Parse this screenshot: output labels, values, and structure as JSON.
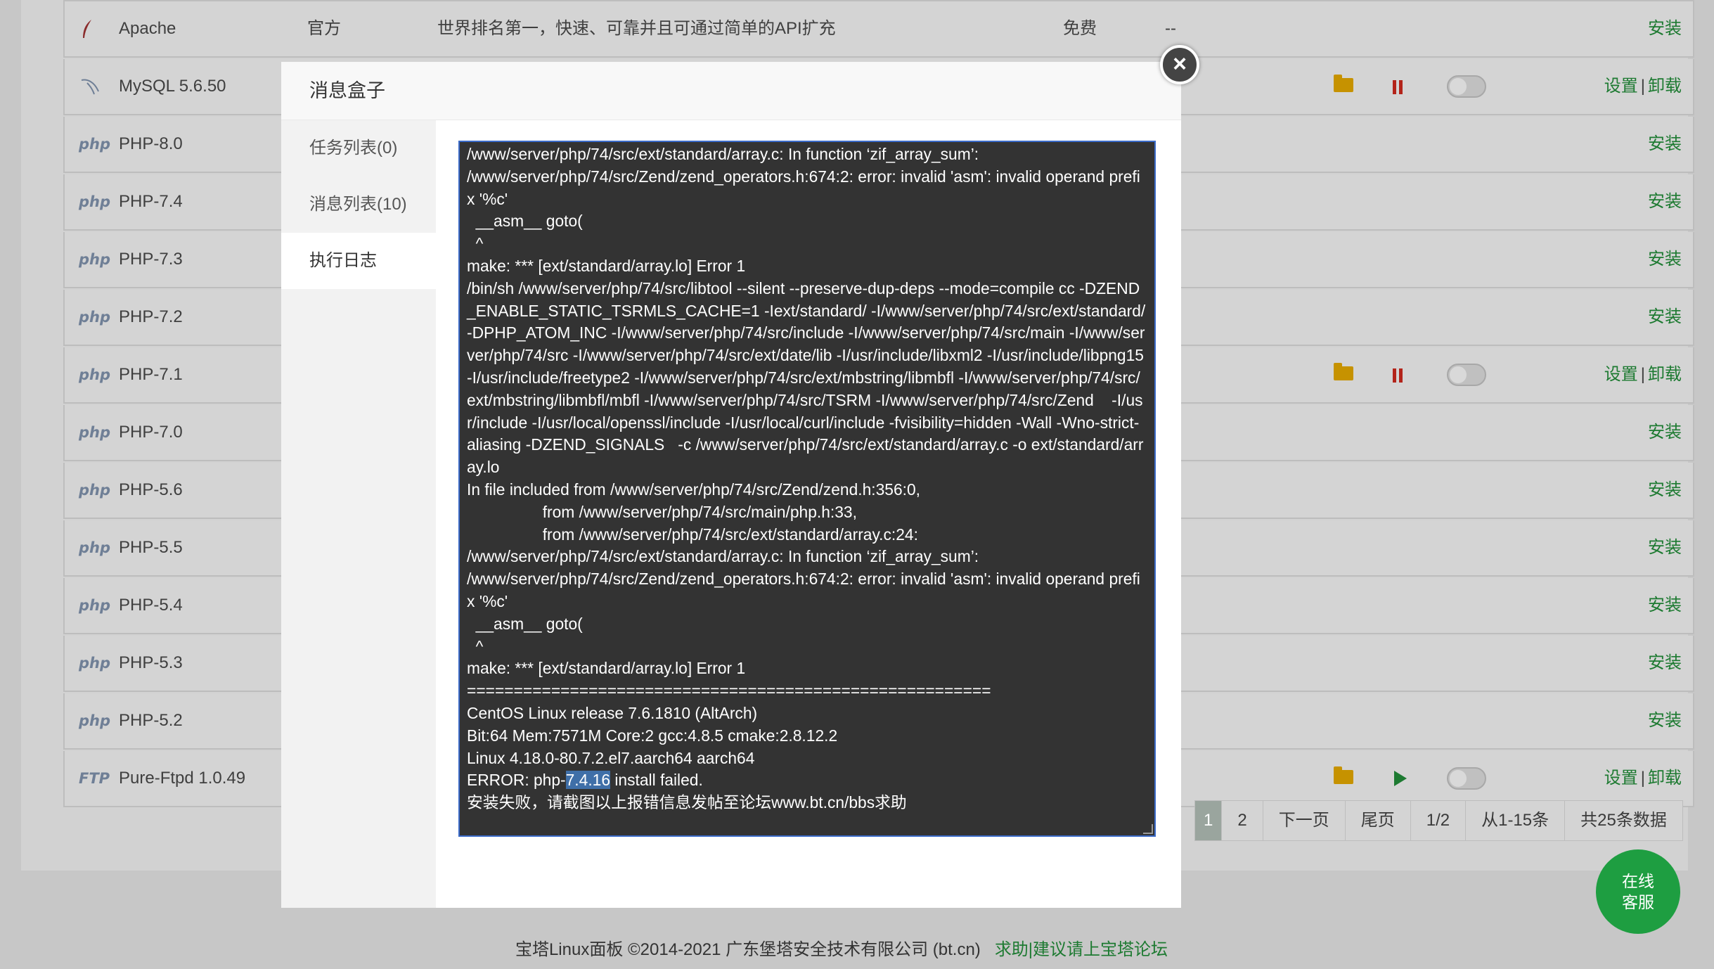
{
  "software_list": [
    {
      "icon": "feather",
      "name": "Apache",
      "developer": "官方",
      "description": "世界排名第一，快速、可靠并且可通过简单的API扩充",
      "price": "免费",
      "expire": "--",
      "actions": [
        "安装"
      ],
      "installed": false
    },
    {
      "icon": "dolphin",
      "name": "MySQL 5.6.50",
      "developer": "",
      "description": "",
      "price": "",
      "expire": "",
      "actions": [
        "设置",
        "卸载"
      ],
      "installed": true,
      "running": true
    },
    {
      "icon": "php",
      "name": "PHP-8.0",
      "actions": [
        "安装"
      ],
      "installed": false
    },
    {
      "icon": "php",
      "name": "PHP-7.4",
      "actions": [
        "安装"
      ],
      "installed": false
    },
    {
      "icon": "php",
      "name": "PHP-7.3",
      "actions": [
        "安装"
      ],
      "installed": false
    },
    {
      "icon": "php",
      "name": "PHP-7.2",
      "actions": [
        "安装"
      ],
      "installed": false
    },
    {
      "icon": "php",
      "name": "PHP-7.1",
      "actions": [
        "设置",
        "卸载"
      ],
      "installed": true,
      "running": true
    },
    {
      "icon": "php",
      "name": "PHP-7.0",
      "actions": [
        "安装"
      ],
      "installed": false
    },
    {
      "icon": "php",
      "name": "PHP-5.6",
      "actions": [
        "安装"
      ],
      "installed": false
    },
    {
      "icon": "php",
      "name": "PHP-5.5",
      "actions": [
        "安装"
      ],
      "installed": false
    },
    {
      "icon": "php",
      "name": "PHP-5.4",
      "actions": [
        "安装"
      ],
      "installed": false
    },
    {
      "icon": "php",
      "name": "PHP-5.3",
      "actions": [
        "安装"
      ],
      "installed": false
    },
    {
      "icon": "php",
      "name": "PHP-5.2",
      "actions": [
        "安装"
      ],
      "installed": false
    },
    {
      "icon": "ftp",
      "name": "Pure-Ftpd 1.0.49",
      "actions": [
        "设置",
        "卸载"
      ],
      "installed": true,
      "running": false
    }
  ],
  "icon_text": {
    "php": "php",
    "ftp": "FTP"
  },
  "pagination": {
    "current": "1",
    "page2": "2",
    "next": "下一页",
    "last": "尾页",
    "page_of": "1/2",
    "range": "从1-15条",
    "total": "共25条数据"
  },
  "footer": {
    "copyright": "宝塔Linux面板 ©2014-2021 广东堡塔安全技术有限公司 (bt.cn)",
    "forum_link": "求助|建议请上宝塔论坛"
  },
  "chat": {
    "line1": "在线",
    "line2": "客服"
  },
  "modal": {
    "title": "消息盒子",
    "close": "×",
    "tabs": [
      "任务列表(0)",
      "消息列表(10)",
      "执行日志"
    ],
    "active_tab": 2,
    "log_lines": [
      "/www/server/php/74/src/ext/standard/array.c: In function ‘zif_array_sum’:",
      "/www/server/php/74/src/Zend/zend_operators.h:674:2: error: invalid 'asm': invalid operand prefix '%c'",
      "  __asm__ goto(",
      "  ^",
      "make: *** [ext/standard/array.lo] Error 1",
      "/bin/sh /www/server/php/74/src/libtool --silent --preserve-dup-deps --mode=compile cc -DZEND_ENABLE_STATIC_TSRMLS_CACHE=1 -Iext/standard/ -I/www/server/php/74/src/ext/standard/ -DPHP_ATOM_INC -I/www/server/php/74/src/include -I/www/server/php/74/src/main -I/www/server/php/74/src -I/www/server/php/74/src/ext/date/lib -I/usr/include/libxml2 -I/usr/include/libpng15 -I/usr/include/freetype2 -I/www/server/php/74/src/ext/mbstring/libmbfl -I/www/server/php/74/src/ext/mbstring/libmbfl/mbfl -I/www/server/php/74/src/TSRM -I/www/server/php/74/src/Zend    -I/usr/include -I/usr/local/openssl/include -I/usr/local/curl/include -fvisibility=hidden -Wall -Wno-strict-aliasing -DZEND_SIGNALS   -c /www/server/php/74/src/ext/standard/array.c -o ext/standard/array.lo",
      "In file included from /www/server/php/74/src/Zend/zend.h:356:0,",
      "                 from /www/server/php/74/src/main/php.h:33,",
      "                 from /www/server/php/74/src/ext/standard/array.c:24:",
      "/www/server/php/74/src/ext/standard/array.c: In function ‘zif_array_sum’:",
      "/www/server/php/74/src/Zend/zend_operators.h:674:2: error: invalid 'asm': invalid operand prefix '%c'",
      "  __asm__ goto(",
      "  ^",
      "make: *** [ext/standard/array.lo] Error 1",
      "========================================================",
      "CentOS Linux release 7.6.1810 (AltArch)",
      "Bit:64 Mem:7571M Core:2 gcc:4.8.5 cmake:2.8.12.2",
      "Linux 4.18.0-80.7.2.el7.aarch64 aarch64"
    ],
    "error_prefix": "ERROR: php-",
    "error_version": "7.4.16",
    "error_suffix": " install failed.",
    "final_line": "安装失败，请截图以上报错信息发帖至论坛www.bt.cn/bbs求助"
  }
}
